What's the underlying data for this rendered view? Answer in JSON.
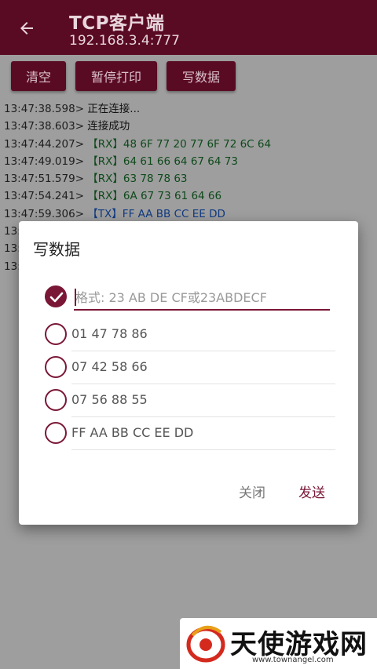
{
  "appbar": {
    "title": "TCP客户端",
    "subtitle": "192.168.3.4:777",
    "back_icon": "arrow-left-icon",
    "background": "#5a0b24"
  },
  "toolbar": {
    "clear_label": "清空",
    "pause_print_label": "暂停打印",
    "write_data_label": "写数据"
  },
  "log": [
    {
      "time": "13:47:38.598>",
      "text": " 正在连接...",
      "kind": "status"
    },
    {
      "time": "13:47:38.603>",
      "text": " 连接成功",
      "kind": "status"
    },
    {
      "time": "13:47:44.207>",
      "text": " 【RX】48 6F 77 20 77 6F 72 6C 64",
      "kind": "rx"
    },
    {
      "time": "13:47:49.019>",
      "text": " 【RX】64 61 66 64 67 64 73",
      "kind": "rx"
    },
    {
      "time": "13:47:51.579>",
      "text": " 【RX】63 78 78 63",
      "kind": "rx"
    },
    {
      "time": "13:47:54.241>",
      "text": " 【RX】6A 67 73 61 64 66",
      "kind": "rx"
    },
    {
      "time": "13:47:59.306>",
      "text": " 【TX】FF AA BB CC EE DD",
      "kind": "tx"
    },
    {
      "time": "13:",
      "text": "",
      "kind": "status"
    },
    {
      "time": "13:",
      "text": "",
      "kind": "status"
    },
    {
      "time": "13:",
      "text": "",
      "kind": "status"
    }
  ],
  "dialog": {
    "title": "写数据",
    "input": {
      "value": "",
      "placeholder": "格式: 23 AB DE CF或23ABDECF"
    },
    "options": [
      {
        "label": "01 47 78 86",
        "checked": false
      },
      {
        "label": "07 42 58 66",
        "checked": false
      },
      {
        "label": "07 56 88 55",
        "checked": false
      },
      {
        "label": "FF AA BB CC EE DD",
        "checked": false
      }
    ],
    "close_label": "关闭",
    "send_label": "发送",
    "accent": "#7a1736"
  },
  "watermark": {
    "text": "天使游戏网",
    "url": "www.townangel.com"
  }
}
